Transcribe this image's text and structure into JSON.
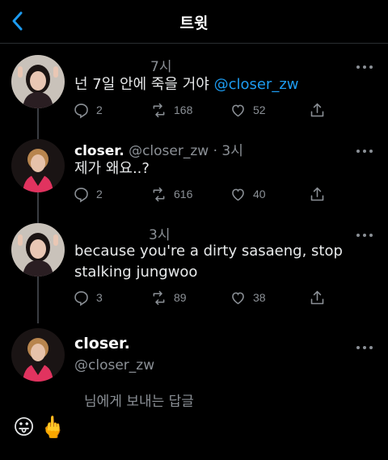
{
  "header": {
    "title": "트윗"
  },
  "tweets": [
    {
      "time": "7시",
      "body": "넌 7일 안에 죽을 거야",
      "mention": "@closer_zw",
      "replies": "2",
      "retweets": "168",
      "likes": "52"
    },
    {
      "name": "closer.",
      "handle": "@closer_zw",
      "sep": " · ",
      "time": "3시",
      "body": "제가 왜요..?",
      "replies": "2",
      "retweets": "616",
      "likes": "40"
    },
    {
      "time": "3시",
      "body": "because you're a dirty sasaeng, stop stalking jungwoo",
      "replies": "3",
      "retweets": "89",
      "likes": "38"
    }
  ],
  "profile": {
    "name": "closer.",
    "handle": "@closer_zw"
  },
  "reply_label": "님에게 보내는 답글",
  "emojis": [
    "😛",
    "🖕"
  ],
  "colors": {
    "accent": "#1d9bf0",
    "background": "#000000",
    "muted": "#8b9096"
  },
  "icons": [
    "back-chevron-icon",
    "more-icon",
    "reply-icon",
    "retweet-icon",
    "like-icon",
    "share-icon"
  ]
}
